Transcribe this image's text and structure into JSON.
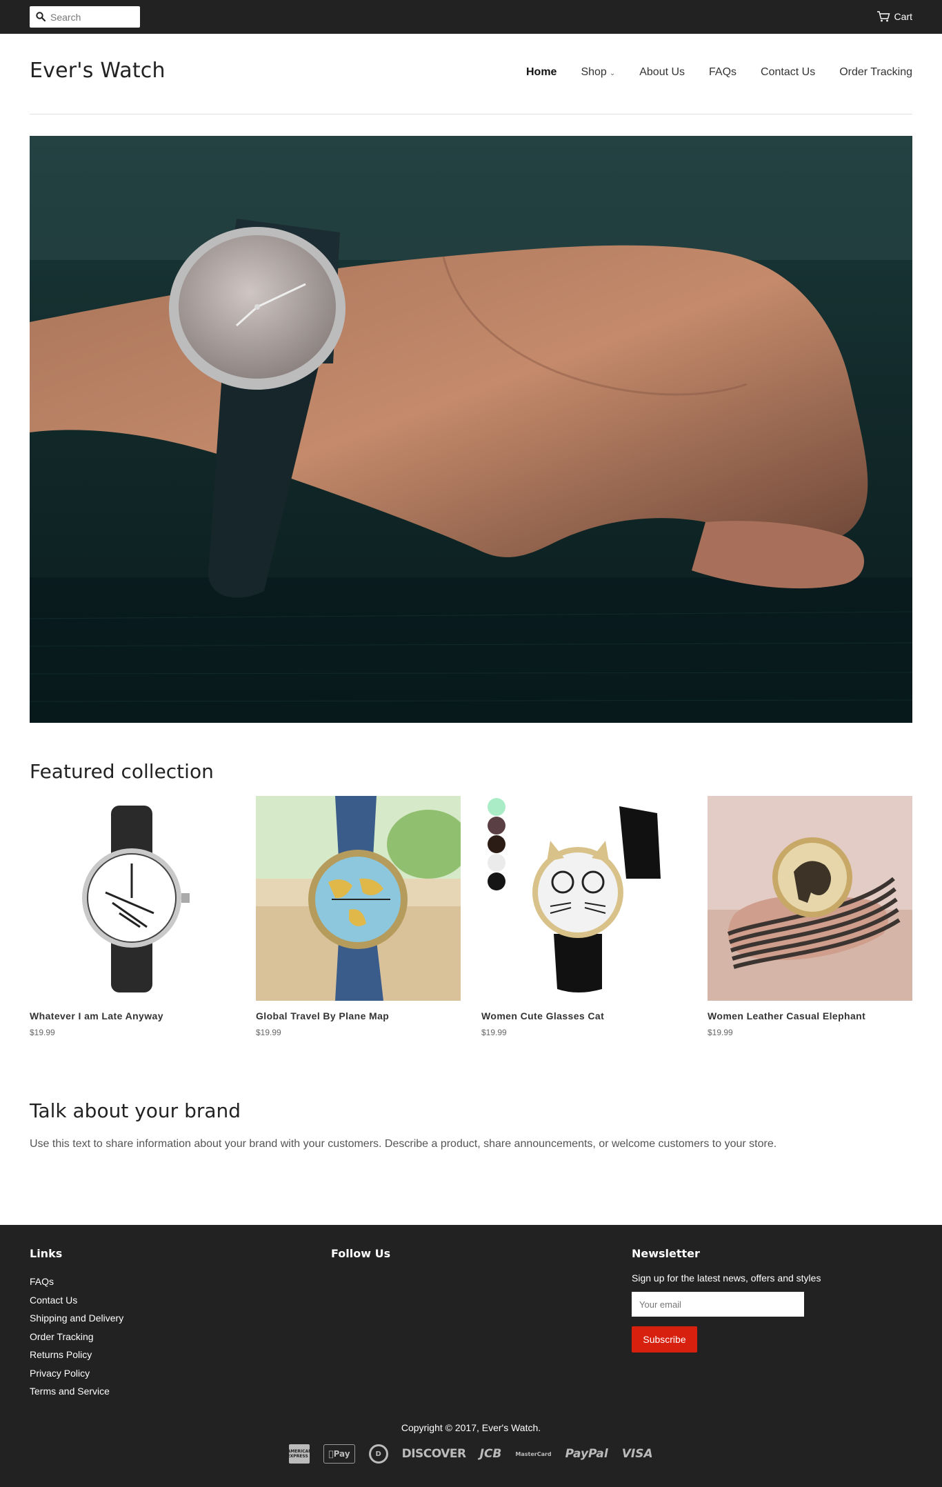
{
  "topbar": {
    "search_placeholder": "Search",
    "cart_label": "Cart"
  },
  "header": {
    "logo": "Ever's Watch",
    "nav": [
      {
        "label": "Home",
        "active": true
      },
      {
        "label": "Shop",
        "has_dropdown": true
      },
      {
        "label": "About Us"
      },
      {
        "label": "FAQs"
      },
      {
        "label": "Contact Us"
      },
      {
        "label": "Order Tracking"
      }
    ]
  },
  "featured": {
    "title": "Featured collection",
    "products": [
      {
        "name": "Whatever I am Late Anyway",
        "price": "$19.99"
      },
      {
        "name": "Global Travel By Plane Map",
        "price": "$19.99"
      },
      {
        "name": "Women Cute Glasses Cat",
        "price": "$19.99"
      },
      {
        "name": "Women Leather Casual Elephant",
        "price": "$19.99"
      }
    ]
  },
  "brand": {
    "title": "Talk about your brand",
    "text": "Use this text to share information about your brand with your customers. Describe a product, share announcements, or welcome customers to your store."
  },
  "footer": {
    "links_title": "Links",
    "links": [
      "FAQs",
      "Contact Us",
      "Shipping and Delivery",
      "Order Tracking",
      "Returns Policy",
      "Privacy Policy",
      "Terms and Service"
    ],
    "follow_title": "Follow Us",
    "newsletter_title": "Newsletter",
    "newsletter_text": "Sign up for the latest news, offers and styles",
    "email_placeholder": "Your email",
    "subscribe_label": "Subscribe",
    "copyright": "Copyright © 2017, Ever's Watch.",
    "payments": {
      "amex": "AMERICAN EXPRESS",
      "apple_pay": "Pay",
      "diners": "D",
      "discover": "DISCOVER",
      "jcb": "JCB",
      "mastercard": "MasterCard",
      "paypal": "PayPal",
      "visa": "VISA"
    }
  },
  "colors": {
    "topbar_bg": "#222222",
    "footer_bg": "#222222",
    "accent": "#d8200e"
  }
}
